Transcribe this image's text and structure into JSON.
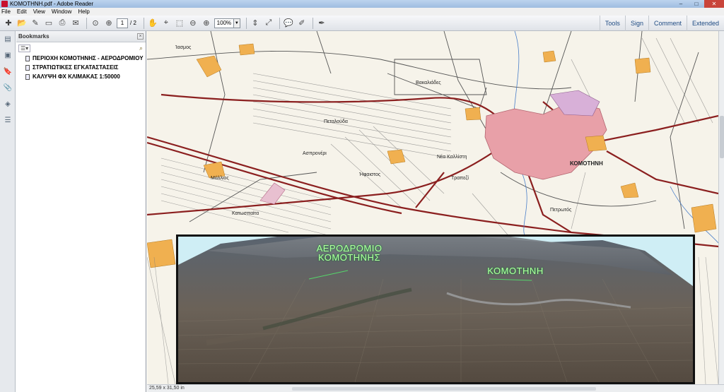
{
  "window": {
    "title": "ΚΟΜΟΤΗΝΗ.pdf - Adobe Reader"
  },
  "menu": [
    "File",
    "Edit",
    "View",
    "Window",
    "Help"
  ],
  "toolbar": {
    "page_current": "1",
    "page_total": "/ 2",
    "zoom": "100%",
    "right_tabs": [
      "Tools",
      "Sign",
      "Comment",
      "Extended"
    ]
  },
  "bookmarks": {
    "title": "Bookmarks",
    "items": [
      "ΠΕΡΙΟΧΗ ΚΟΜΟΤΗΝΗΣ - ΑΕΡΟΔΡΟΜΙΟΥ",
      "ΣΤΡΑΤΙΩΤΙΚΕΣ ΕΓΚΑΤΑΣΤΑΣΕΙΣ",
      "ΚΑΛΥΨΗ ΦΧ ΚΛΙΜΑΚΑΣ 1:50000"
    ]
  },
  "map": {
    "labels": {
      "komotini": "ΚΟΜΟΤΗΝΗ",
      "aspronero": "Ασπρονέρι",
      "pataria": "Πεταλούδα",
      "nea_kallisti": "Νέα Καλλίστη",
      "vanianeika": "Βακαλιάδες",
      "ifestos": "Ήφαιστος",
      "trapeza": "Τραπεζί",
      "petrotopos": "Πετρωτός",
      "stilos": "Μάλλιος",
      "iasmos": "Ίασμος",
      "kato_terma": "Κατωσπαίτα"
    }
  },
  "satellite": {
    "label_airport": "ΑΕΡΟΔΡΟΜΙΟ ΚΟΜΟΤΗΝΗΣ",
    "label_city": "ΚΟΜΟΤΗΝΗ"
  },
  "status": {
    "page_size": "25,59 x 31,50 in"
  },
  "colors": {
    "road": "#8b1f1f",
    "urban": "#e8a0a8",
    "village": "#f0b050",
    "sat_sky": "#cfeef5"
  }
}
